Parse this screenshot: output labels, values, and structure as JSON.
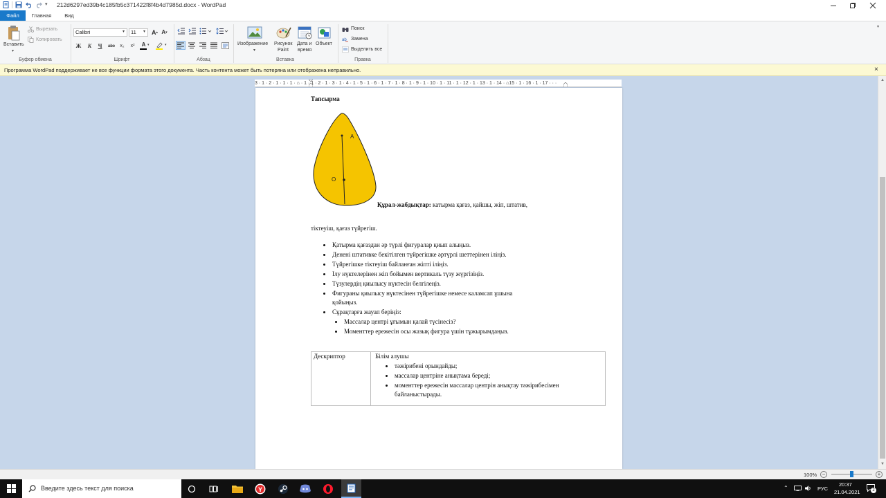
{
  "window": {
    "title": "212d6297ed39b4c185fb5c371422f8f4b4d7985d.docx - WordPad"
  },
  "tabs": [
    {
      "label": "Файл",
      "active": true
    },
    {
      "label": "Главная",
      "active": false
    },
    {
      "label": "Вид",
      "active": false
    }
  ],
  "ribbon": {
    "clipboard": {
      "paste": "Вставить",
      "cut": "Вырезать",
      "copy": "Копировать",
      "group": "Буфер обмена"
    },
    "font": {
      "family": "Calibri",
      "size": "11",
      "bold": "Ж",
      "italic": "К",
      "underline": "Ч",
      "strike": "abe",
      "sub": "x₂",
      "sup": "x²",
      "color_glyph": "A",
      "group": "Шрифт"
    },
    "paragraph": {
      "group": "Абзац"
    },
    "insert": {
      "image": "Изображение",
      "paint_line1": "Рисунок",
      "paint_line2": "Paint",
      "datetime_line1": "Дата и",
      "datetime_line2": "время",
      "object": "Объект",
      "group": "Вставка"
    },
    "editing": {
      "find": "Поиск",
      "replace": "Замена",
      "select_all": "Выделить все",
      "group": "Правка"
    }
  },
  "infobar": {
    "message": "Программа WordPad поддерживает не все функции формата этого документа. Часть контента может быть потеряна или отображена неправильно.",
    "close": "×"
  },
  "ruler": {
    "text": "3 · 1 · 2 · 1 · 1 · 1 · ⌂ · 1 · 1 · 2 · 1 · 3 · 1 · 4 · 1 · 5 · 1 · 6 · 1 · 7 · 1 · 8 · 1 · 9 · 1 · 10 · 1 · 11 · 1 · 12 · 1 · 13 · 1 · 14 · ⌂15 · 1 · 16 · 1 · 17 · · ·"
  },
  "document": {
    "heading": "Тапсырма",
    "figure_labels": {
      "a": "A",
      "o": "O"
    },
    "tools_bold": "Құрал-жабдықтар:",
    "tools_rest": " катырма қағаз, қайшы, жіп, штатив,",
    "tools_line2": "тіктеуіш,  қағаз  түйрегіш.",
    "bullets": [
      "Қатырма қағаздан әр түрлі фигуралар  қиып алыңыз.",
      "Денені штативке бекітілген  түйрегішке  әртүрлі шеттерінен  іліңіз.",
      "Түйрегішке  тіктеуіш  байланған жіпті  іліңіз.",
      "Ілу нүктелерінен  жіп бойымен вертикаль түзу жүргізіңіз.",
      "Түзулердің  қиылысу нүктесін  белгілеңіз.",
      "Фигураны қиылысу нүктесінен  түйрегішке  немесе каламсап ұшына",
      "Сұрақтарға жауап беріңіз:"
    ],
    "bullet6_cont": "қойыңыз.",
    "sub_bullets": [
      "Массалар центрі ұғымын қалай түсінесіз?",
      "Моменттер ережесін осы жазық фигура  үшін  тұжырымдаңыз."
    ],
    "table": {
      "col1": "Дескриптор",
      "col2_head": "Білім  алушы",
      "items": [
        "тәжірибені  орындайды;",
        "массалар центріне анықтама береді;",
        "моменттер ережесін массалар центрін анықтау тәжірибесімен"
      ],
      "item3_cont": "байланыстырады."
    }
  },
  "status": {
    "zoom": "100%",
    "minus": "−",
    "plus": "+",
    "zoom_level_fraction": 0.5
  },
  "taskbar": {
    "search_placeholder": "Введите здесь текст для поиска",
    "lang": "РУС",
    "time": "20:37",
    "date": "21.04.2021",
    "notif_count": "2"
  },
  "colors": {
    "accent": "#1979ca",
    "infobar": "#fcf9d3",
    "workarea": "#c6d6ea",
    "figure_fill": "#f5c400"
  }
}
